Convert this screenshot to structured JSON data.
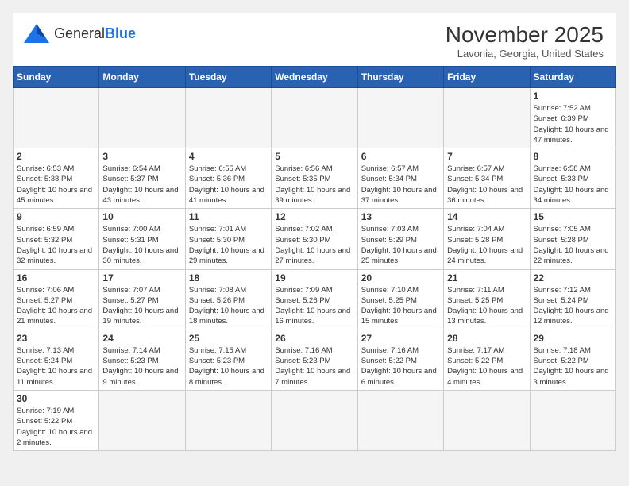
{
  "logo": {
    "text_general": "General",
    "text_blue": "Blue"
  },
  "header": {
    "month_title": "November 2025",
    "location": "Lavonia, Georgia, United States"
  },
  "weekdays": [
    "Sunday",
    "Monday",
    "Tuesday",
    "Wednesday",
    "Thursday",
    "Friday",
    "Saturday"
  ],
  "weeks": [
    [
      {
        "day": null,
        "info": null
      },
      {
        "day": null,
        "info": null
      },
      {
        "day": null,
        "info": null
      },
      {
        "day": null,
        "info": null
      },
      {
        "day": null,
        "info": null
      },
      {
        "day": null,
        "info": null
      },
      {
        "day": "1",
        "info": "Sunrise: 7:52 AM\nSunset: 6:39 PM\nDaylight: 10 hours and 47 minutes."
      }
    ],
    [
      {
        "day": "2",
        "info": "Sunrise: 6:53 AM\nSunset: 5:38 PM\nDaylight: 10 hours and 45 minutes."
      },
      {
        "day": "3",
        "info": "Sunrise: 6:54 AM\nSunset: 5:37 PM\nDaylight: 10 hours and 43 minutes."
      },
      {
        "day": "4",
        "info": "Sunrise: 6:55 AM\nSunset: 5:36 PM\nDaylight: 10 hours and 41 minutes."
      },
      {
        "day": "5",
        "info": "Sunrise: 6:56 AM\nSunset: 5:35 PM\nDaylight: 10 hours and 39 minutes."
      },
      {
        "day": "6",
        "info": "Sunrise: 6:57 AM\nSunset: 5:34 PM\nDaylight: 10 hours and 37 minutes."
      },
      {
        "day": "7",
        "info": "Sunrise: 6:57 AM\nSunset: 5:34 PM\nDaylight: 10 hours and 36 minutes."
      },
      {
        "day": "8",
        "info": "Sunrise: 6:58 AM\nSunset: 5:33 PM\nDaylight: 10 hours and 34 minutes."
      }
    ],
    [
      {
        "day": "9",
        "info": "Sunrise: 6:59 AM\nSunset: 5:32 PM\nDaylight: 10 hours and 32 minutes."
      },
      {
        "day": "10",
        "info": "Sunrise: 7:00 AM\nSunset: 5:31 PM\nDaylight: 10 hours and 30 minutes."
      },
      {
        "day": "11",
        "info": "Sunrise: 7:01 AM\nSunset: 5:30 PM\nDaylight: 10 hours and 29 minutes."
      },
      {
        "day": "12",
        "info": "Sunrise: 7:02 AM\nSunset: 5:30 PM\nDaylight: 10 hours and 27 minutes."
      },
      {
        "day": "13",
        "info": "Sunrise: 7:03 AM\nSunset: 5:29 PM\nDaylight: 10 hours and 25 minutes."
      },
      {
        "day": "14",
        "info": "Sunrise: 7:04 AM\nSunset: 5:28 PM\nDaylight: 10 hours and 24 minutes."
      },
      {
        "day": "15",
        "info": "Sunrise: 7:05 AM\nSunset: 5:28 PM\nDaylight: 10 hours and 22 minutes."
      }
    ],
    [
      {
        "day": "16",
        "info": "Sunrise: 7:06 AM\nSunset: 5:27 PM\nDaylight: 10 hours and 21 minutes."
      },
      {
        "day": "17",
        "info": "Sunrise: 7:07 AM\nSunset: 5:27 PM\nDaylight: 10 hours and 19 minutes."
      },
      {
        "day": "18",
        "info": "Sunrise: 7:08 AM\nSunset: 5:26 PM\nDaylight: 10 hours and 18 minutes."
      },
      {
        "day": "19",
        "info": "Sunrise: 7:09 AM\nSunset: 5:26 PM\nDaylight: 10 hours and 16 minutes."
      },
      {
        "day": "20",
        "info": "Sunrise: 7:10 AM\nSunset: 5:25 PM\nDaylight: 10 hours and 15 minutes."
      },
      {
        "day": "21",
        "info": "Sunrise: 7:11 AM\nSunset: 5:25 PM\nDaylight: 10 hours and 13 minutes."
      },
      {
        "day": "22",
        "info": "Sunrise: 7:12 AM\nSunset: 5:24 PM\nDaylight: 10 hours and 12 minutes."
      }
    ],
    [
      {
        "day": "23",
        "info": "Sunrise: 7:13 AM\nSunset: 5:24 PM\nDaylight: 10 hours and 11 minutes."
      },
      {
        "day": "24",
        "info": "Sunrise: 7:14 AM\nSunset: 5:23 PM\nDaylight: 10 hours and 9 minutes."
      },
      {
        "day": "25",
        "info": "Sunrise: 7:15 AM\nSunset: 5:23 PM\nDaylight: 10 hours and 8 minutes."
      },
      {
        "day": "26",
        "info": "Sunrise: 7:16 AM\nSunset: 5:23 PM\nDaylight: 10 hours and 7 minutes."
      },
      {
        "day": "27",
        "info": "Sunrise: 7:16 AM\nSunset: 5:22 PM\nDaylight: 10 hours and 6 minutes."
      },
      {
        "day": "28",
        "info": "Sunrise: 7:17 AM\nSunset: 5:22 PM\nDaylight: 10 hours and 4 minutes."
      },
      {
        "day": "29",
        "info": "Sunrise: 7:18 AM\nSunset: 5:22 PM\nDaylight: 10 hours and 3 minutes."
      }
    ],
    [
      {
        "day": "30",
        "info": "Sunrise: 7:19 AM\nSunset: 5:22 PM\nDaylight: 10 hours and 2 minutes."
      },
      {
        "day": null,
        "info": null
      },
      {
        "day": null,
        "info": null
      },
      {
        "day": null,
        "info": null
      },
      {
        "day": null,
        "info": null
      },
      {
        "day": null,
        "info": null
      },
      {
        "day": null,
        "info": null
      }
    ]
  ]
}
